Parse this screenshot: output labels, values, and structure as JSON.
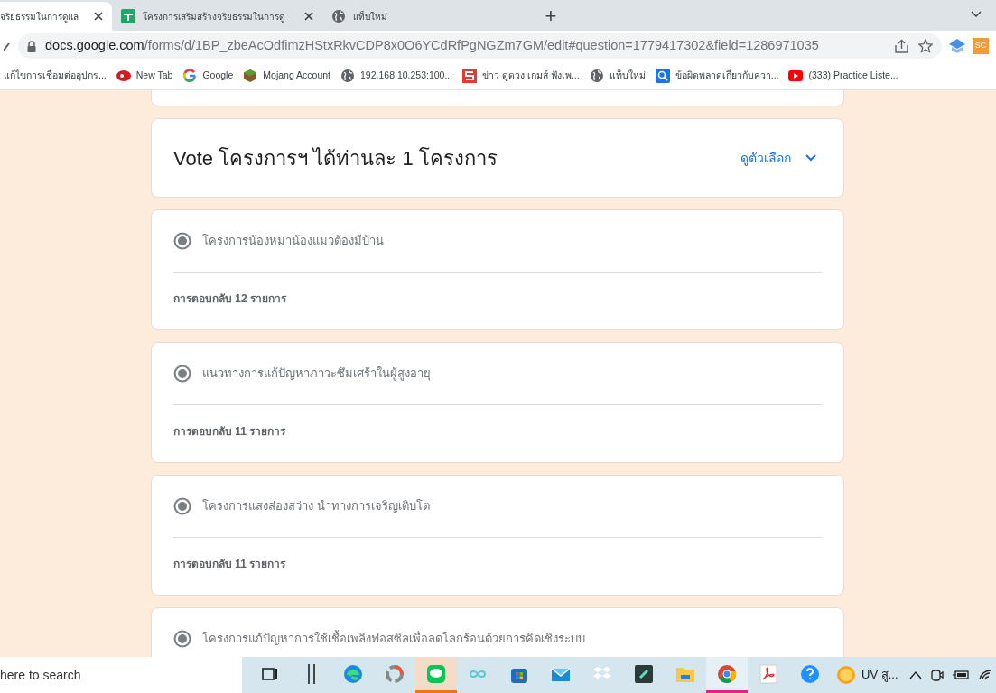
{
  "browser": {
    "tabs": [
      {
        "title": "จริยธรรมในการดูแล",
        "selected": true
      },
      {
        "title": "โครงการเสริมสร้างจริยธรรมในการดู",
        "selected": false
      },
      {
        "title": "แท็บใหม่",
        "selected": false
      }
    ],
    "new_tab": "+",
    "url_host": "docs.google.com",
    "url_path": "/forms/d/1BP_zbeAcOdfimzHStxRkvCDP8x0O6YCdRfPgNGZm7GM/edit#question=1779417302&field=1286971035",
    "extension_badge": "SC",
    "bookmarks": [
      {
        "label": "แก้ไขการเชื่อมต่ออุปกร..."
      },
      {
        "label": "New Tab"
      },
      {
        "label": "Google"
      },
      {
        "label": "Mojang Account"
      },
      {
        "label": "192.168.10.253:100..."
      },
      {
        "label": "ข่าว ดูดวง เกมส์ ฟังเพ..."
      },
      {
        "label": "แท็บใหม่"
      },
      {
        "label": "ข้อผิดพลาดเกี่ยวกับควา..."
      },
      {
        "label": "(333) Practice Liste..."
      }
    ]
  },
  "question": {
    "title": "Vote โครงการฯ ได้ท่านละ 1 โครงการ",
    "options_link": "ดูตัวเลือก"
  },
  "answers": [
    {
      "label": "โครงการน้องหมาน้องแมวต้องมีบ้าน",
      "selected": true,
      "responses": "การตอบกลับ 12 รายการ"
    },
    {
      "label": "แนวทางการแก้ปัญหาภาวะซึมเศร้าในผู้สูงอายุ",
      "selected": true,
      "responses": "การตอบกลับ 11 รายการ"
    },
    {
      "label": "โครงการแสงส่องสว่าง นำทางการเจริญเติบโต",
      "selected": true,
      "responses": "การตอบกลับ 11 รายการ"
    },
    {
      "label": "โครงการแก้ปัญหาการใช้เชื้อเพลิงฟอสซิลเพื่อลดโลกร้อนด้วยการคิดเชิงระบบ",
      "selected": true
    }
  ],
  "taskbar": {
    "search_placeholder": "here to search",
    "apps": [
      {
        "kind": "taskview",
        "active": false
      },
      {
        "kind": "bars",
        "active": false
      },
      {
        "kind": "edge",
        "active": false
      },
      {
        "kind": "ring",
        "active": false
      },
      {
        "kind": "line",
        "active": true
      },
      {
        "kind": "infinity",
        "active": false
      },
      {
        "kind": "store",
        "active": false
      },
      {
        "kind": "mail",
        "active": false
      },
      {
        "kind": "dropbox",
        "active": false
      },
      {
        "kind": "filmora",
        "active": false
      },
      {
        "kind": "folder",
        "active": false
      },
      {
        "kind": "chrome",
        "active": true
      },
      {
        "kind": "pdf",
        "active": false
      },
      {
        "kind": "help",
        "active": false
      }
    ],
    "running_app": "UV สู..."
  }
}
